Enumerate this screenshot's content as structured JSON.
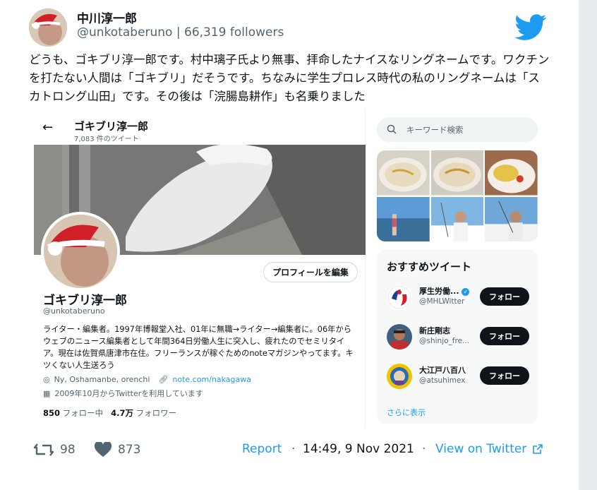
{
  "tweet": {
    "author_name": "中川淳一郎",
    "handle": "@unkotaberuno",
    "separator": " | ",
    "followers": "66,319 followers",
    "text": "どうも、ゴキブリ淳一郎です。村中璃子氏より無事、拝命したナイスなリングネームです。ワクチンを打たない人間は「ゴキブリ」だそうです。ちなみに学生プロレス時代の私のリングネームは「スカトロング山田」です。その後は「浣腸島耕作」も名乗りました",
    "likes": "873",
    "retweets": "98",
    "report": "Report",
    "dot": "·",
    "time": "14:49, 9 Nov 2021",
    "view_on": "View on Twitter",
    "brand_color": "#1d9bf0"
  },
  "screenshot": {
    "profile": {
      "display_name": "ゴキブリ淳一郎",
      "tweet_count": "7,083 件のツイート",
      "handle": "@unkotaberuno",
      "edit_button": "プロフィールを編集",
      "bio": "ライター・編集者。1997年博報堂入社、01年に無職→ライター→編集者に。06年からウェブのニュース編集者として年間364日労働人生に突入し、疲れたのでセミリタイア。現在は佐賀県唐津市在住。フリーランスが稼ぐためのnoteマガジンやってます。キツくない人生送ろう",
      "location": "Ny, Oshamanbe, orenchi",
      "link": "note.com/nakagawa",
      "joined": "2009年10月からTwitterを利用しています",
      "following_count": "850",
      "following_label": "フォロー中",
      "followers_count": "4.7万",
      "followers_label": "フォロワー"
    },
    "search_placeholder": "キーワード検索",
    "recommend": {
      "title": "おすすめツイート",
      "items": [
        {
          "name": "厚生労働...",
          "handle": "@MHLWitter",
          "verified": true,
          "button": "フォロー"
        },
        {
          "name": "新庄剛志",
          "handle": "@shinjo_fre...",
          "verified": false,
          "button": "フォロー"
        },
        {
          "name": "大江戸八百八",
          "handle": "@atsuhimex",
          "verified": false,
          "button": "フォロー"
        }
      ],
      "show_more": "さらに表示"
    }
  }
}
